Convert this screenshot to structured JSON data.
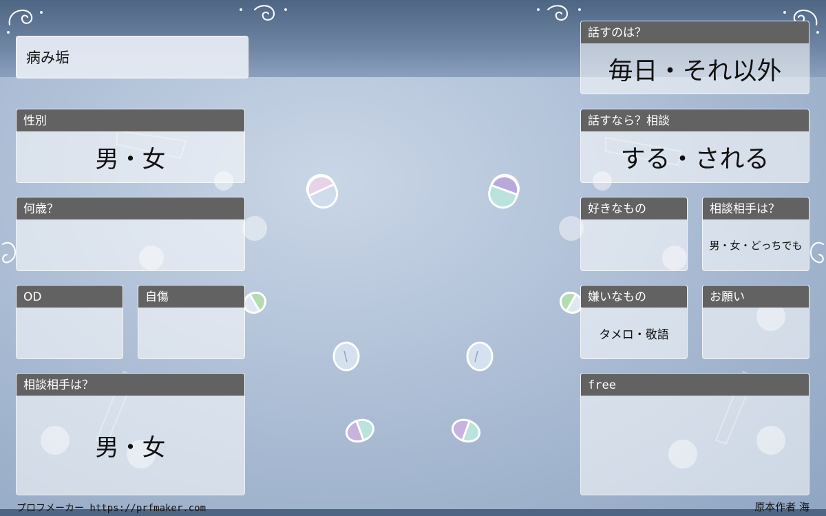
{
  "name_field": "病み垢",
  "left": {
    "gender": {
      "label": "性別",
      "value": "男・女"
    },
    "age": {
      "label": "何歳？",
      "value": ""
    },
    "od": {
      "label": "OD",
      "value": ""
    },
    "selfharm": {
      "label": "自傷",
      "value": ""
    },
    "consult_partner": {
      "label": "相談相手は？",
      "value": "男・女"
    }
  },
  "right": {
    "talk": {
      "label": "話すのは？",
      "value": "毎日・それ以外"
    },
    "consult": {
      "label": "話すなら？相談",
      "value": "する・される"
    },
    "likes": {
      "label": "好きなもの",
      "value": ""
    },
    "consult_partner": {
      "label": "相談相手は？",
      "value": "男・女・どっちでも"
    },
    "dislikes": {
      "label": "嫌いなもの",
      "value": "タメロ・敬語"
    },
    "request": {
      "label": "お願い",
      "value": ""
    },
    "free": {
      "label": "free",
      "value": ""
    }
  },
  "footer": {
    "maker": "プロフメーカー https://prfmaker.com",
    "author": "原本作者 海"
  },
  "colors": {
    "header_bar": "#626262",
    "top_band": "#4e6584",
    "background": "#aebfd6"
  }
}
